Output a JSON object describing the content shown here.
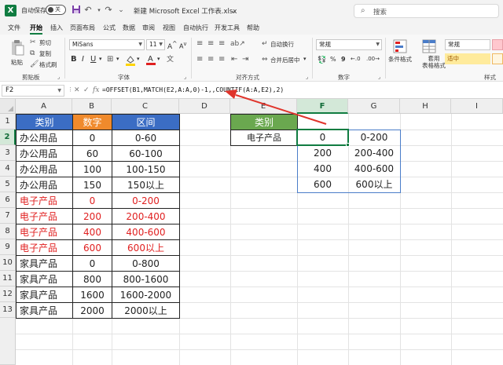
{
  "titlebar": {
    "app_logo": "X",
    "autosave_label": "自动保存",
    "autosave_state": "关",
    "doc_title": "新建 Microsoft Excel 工作表.xlsx",
    "search_placeholder": "搜索"
  },
  "menu": {
    "tabs": [
      "文件",
      "开始",
      "插入",
      "页面布局",
      "公式",
      "数据",
      "审阅",
      "视图",
      "自动执行",
      "开发工具",
      "帮助"
    ],
    "active": "开始"
  },
  "ribbon": {
    "paste_label": "粘贴",
    "cut_label": "剪切",
    "copy_label": "复制",
    "format_painter_label": "格式刷",
    "clipboard_group": "剪贴板",
    "font_name": "MiSans",
    "font_size": "11",
    "font_group": "字体",
    "wrap_text_label": "自动换行",
    "merge_label": "合并后居中",
    "alignment_group": "对齐方式",
    "number_format": "常规",
    "number_group": "数字",
    "conditional_format_label": "条件格式",
    "table_format_label": "套用\n表格格式",
    "style_normal": "常规",
    "style_neutral": "适中",
    "style_group": "样式",
    "colors": {
      "accent": "#107c41",
      "style_neutral_bg": "#ffeb9c",
      "style_neutral_fg": "#9c5700"
    }
  },
  "formula_bar": {
    "name_box": "F2",
    "formula": "=OFFSET(B1,MATCH(E2,A:A,0)-1,,COUNTIF(A:A,E2),2)"
  },
  "sheet": {
    "columns": [
      "A",
      "B",
      "C",
      "D",
      "E",
      "F",
      "G",
      "H",
      "I"
    ],
    "rows": [
      "1",
      "2",
      "3",
      "4",
      "5",
      "6",
      "7",
      "8",
      "9",
      "10",
      "11",
      "12",
      "13"
    ],
    "selected_column": "F",
    "selected_row": "2",
    "table1": {
      "headers": [
        "类别",
        "数字",
        "区间"
      ],
      "rows": [
        [
          "办公用品",
          "0",
          "0-60",
          false
        ],
        [
          "办公用品",
          "60",
          "60-100",
          false
        ],
        [
          "办公用品",
          "100",
          "100-150",
          false
        ],
        [
          "办公用品",
          "150",
          "150以上",
          false
        ],
        [
          "电子产品",
          "0",
          "0-200",
          true
        ],
        [
          "电子产品",
          "200",
          "200-400",
          true
        ],
        [
          "电子产品",
          "400",
          "400-600",
          true
        ],
        [
          "电子产品",
          "600",
          "600以上",
          true
        ],
        [
          "家具产品",
          "0",
          "0-800",
          false
        ],
        [
          "家具产品",
          "800",
          "800-1600",
          false
        ],
        [
          "家具产品",
          "1600",
          "1600-2000",
          false
        ],
        [
          "家具产品",
          "2000",
          "2000以上",
          false
        ]
      ]
    },
    "lookup": {
      "header": "类别",
      "value": "电子产品"
    },
    "spill": [
      [
        "0",
        "0-200"
      ],
      [
        "200",
        "200-400"
      ],
      [
        "400",
        "400-600"
      ],
      [
        "600",
        "600以上"
      ]
    ],
    "colors": {
      "header_blue": "#3b6dc4",
      "header_orange": "#f08a2c",
      "header_green": "#6aa84f",
      "highlight_red": "#e02020",
      "arrow_red": "#e0342b"
    }
  }
}
